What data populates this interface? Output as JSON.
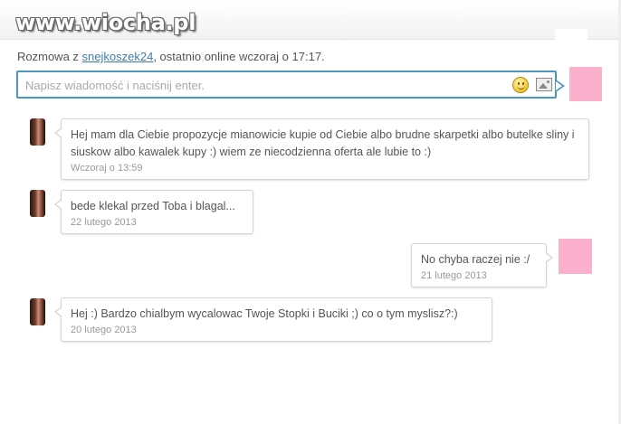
{
  "watermark": "www.wiocha.pl",
  "header": {
    "prefix": "Rozmowa z",
    "username": "snejkoszek24",
    "suffix": ", ostatnio online wczoraj o 17:17."
  },
  "composer": {
    "placeholder": "Napisz wiadomość i naciśnij enter.",
    "emoji_icon": "smiley-icon",
    "image_icon": "image-icon"
  },
  "colors": {
    "accent": "#4a97c4",
    "self_avatar": "#fbb1cb",
    "link": "#3d7db3"
  },
  "messages": [
    {
      "side": "left",
      "text": "Hej mam dla Ciebie propozycje mianowicie kupie od Ciebie albo brudne skarpetki albo butelke sliny i siuskow albo kawalek kupy :) wiem ze niecodzienna oferta ale lubie to :)",
      "time": "Wczoraj o 13:59"
    },
    {
      "side": "left",
      "text": "bede klekal przed Toba i blagal...",
      "time": "22 lutego 2013"
    },
    {
      "side": "right",
      "text": "No chyba raczej nie :/",
      "time": "21 lutego 2013"
    },
    {
      "side": "left",
      "text": "Hej :) Bardzo chialbym wycalowac Twoje Stopki i Buciki ;) co o tym myslisz?:)",
      "time": "20 lutego 2013"
    }
  ]
}
